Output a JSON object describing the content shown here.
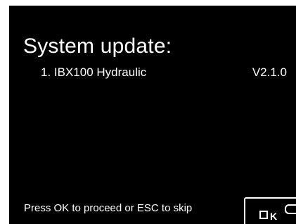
{
  "dialog": {
    "title": "System update:",
    "updates": [
      {
        "name": "1. IBX100 Hydraulic",
        "version": "V2.1.0"
      }
    ],
    "prompt": "Press OK to proceed or ESC to skip",
    "ok_button": {
      "label": "OK"
    }
  }
}
